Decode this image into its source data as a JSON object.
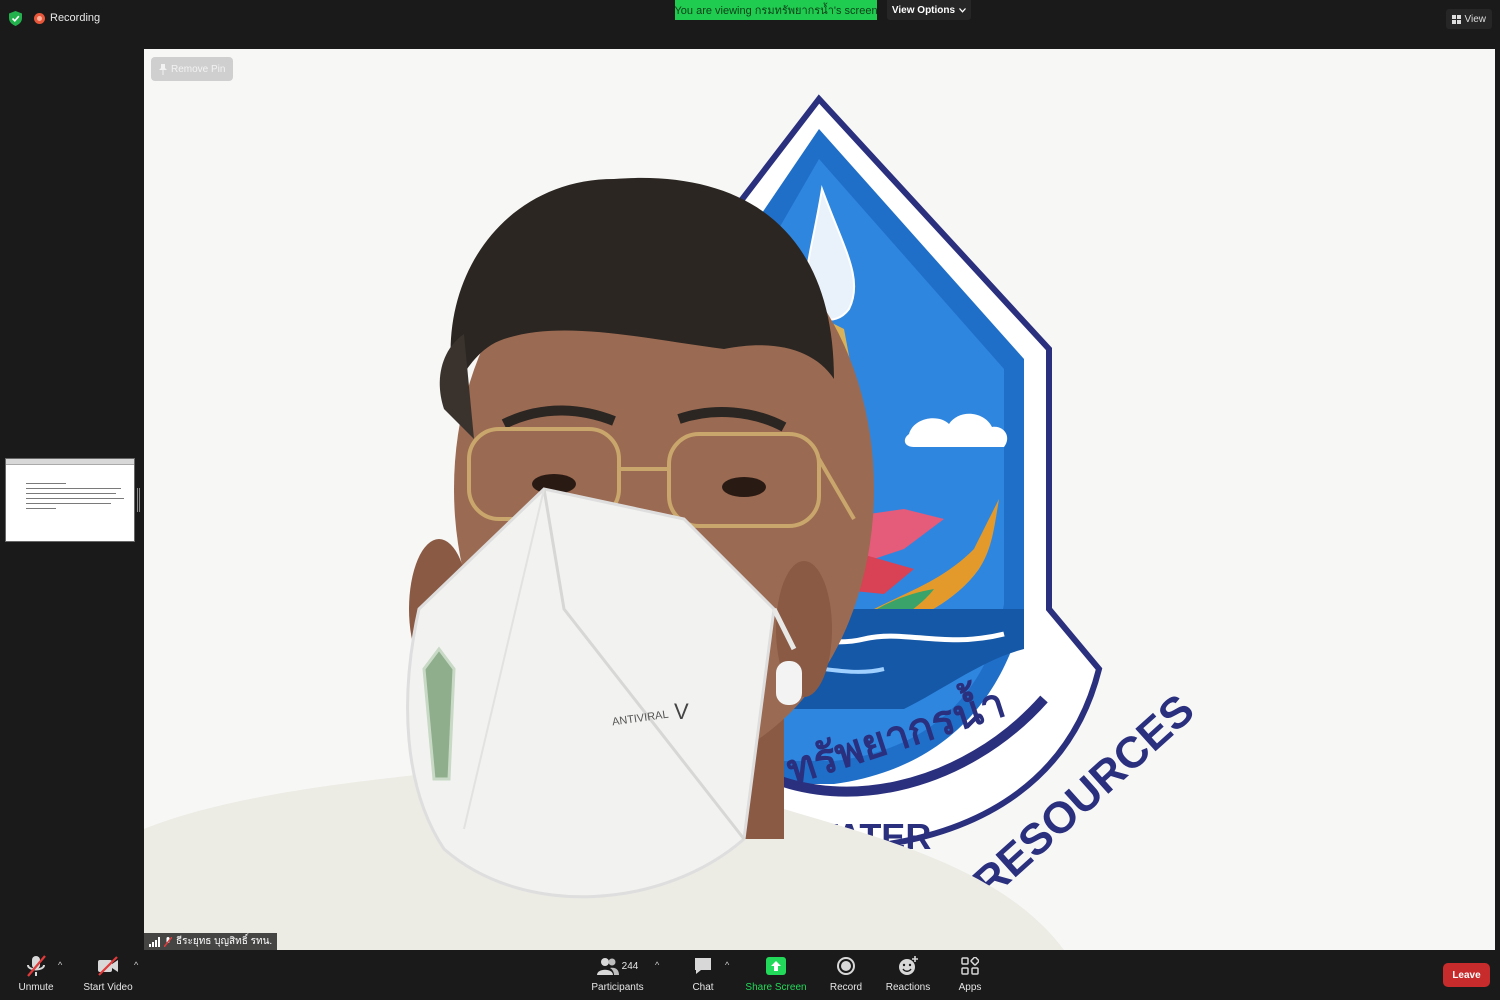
{
  "topbar": {
    "recording_label": "Recording",
    "viewing_label": "You are viewing กรมทรัพยากรน้ำ's screen",
    "view_options_label": "View Options",
    "view_label": "View"
  },
  "video": {
    "remove_pin_label": "Remove Pin",
    "participant_name": "ธีระยุทธ บุญสิทธิ์ รทน."
  },
  "toolbar": {
    "unmute_label": "Unmute",
    "start_video_label": "Start Video",
    "participants_count": "244",
    "participants_label": "Participants",
    "chat_label": "Chat",
    "share_screen_label": "Share Screen",
    "record_label": "Record",
    "reactions_label": "Reactions",
    "apps_label": "Apps",
    "leave_label": "Leave"
  },
  "colors": {
    "accent_green": "#23d959",
    "leave_red": "#c72b2b",
    "recording_red": "#e8573a",
    "logo_blue": "#1f6fc9",
    "logo_navy": "#2a2f7e"
  },
  "icons": [
    "shield-icon",
    "recording-icon",
    "chevron-down-icon",
    "grid-icon",
    "pin-icon",
    "signal-icon",
    "muted-mic-icon",
    "video-off-icon",
    "participants-icon",
    "chat-icon",
    "share-screen-icon",
    "record-icon",
    "reactions-icon",
    "apps-icon"
  ]
}
